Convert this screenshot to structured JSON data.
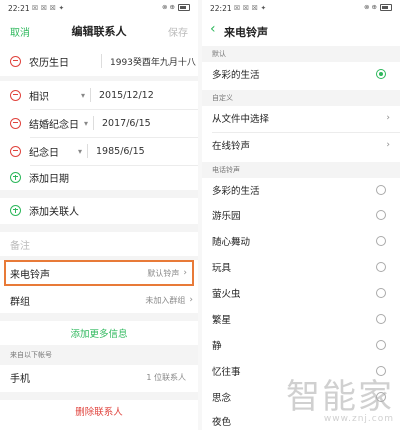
{
  "colors": {
    "accent": "#2eb85c",
    "delete": "#e0433d",
    "highlight": "#e87a38"
  },
  "left": {
    "status": {
      "time": "22:21",
      "indicators": "☒ ☒ ☒ ✦",
      "right": "⊗ ⊕",
      "battery": "▭"
    },
    "header": {
      "cancel": "取消",
      "title": "编辑联系人",
      "save": "保存"
    },
    "lunar_birthday": {
      "label": "农历生日",
      "value": "1993癸酉年九月十八"
    },
    "dates": [
      {
        "label": "相识",
        "value": "2015/12/12"
      },
      {
        "label": "结婚纪念日",
        "value": "2017/6/15"
      },
      {
        "label": "纪念日",
        "value": "1985/6/15"
      }
    ],
    "add_date": "添加日期",
    "add_related": "添加关联人",
    "notes_placeholder": "备注",
    "ringtone": {
      "label": "来电铃声",
      "value": "默认铃声"
    },
    "group": {
      "label": "群组",
      "value": "未加入群组"
    },
    "add_more": "添加更多信息",
    "from_accounts": "来自以下帐号",
    "account": {
      "label": "手机",
      "value": "1 位联系人"
    },
    "delete": "删除联系人"
  },
  "right": {
    "status": {
      "time": "22:21",
      "indicators": "☒ ☒ ☒ ✦",
      "right": "⊗ ⊕",
      "battery": "▭"
    },
    "header": {
      "back": "‹",
      "title": "来电铃声"
    },
    "default_section": "默认",
    "default_item": "多彩的生活",
    "custom_section": "自定义",
    "custom_items": [
      "从文件中选择",
      "在线铃声"
    ],
    "ringtone_section": "电话铃声",
    "ringtones": [
      "多彩的生活",
      "游乐园",
      "随心舞动",
      "玩具",
      "萤火虫",
      "繁星",
      "静",
      "忆往事",
      "思念",
      "夜色"
    ],
    "watermark": {
      "big": "智能家",
      "small": "www.znj.com"
    }
  }
}
